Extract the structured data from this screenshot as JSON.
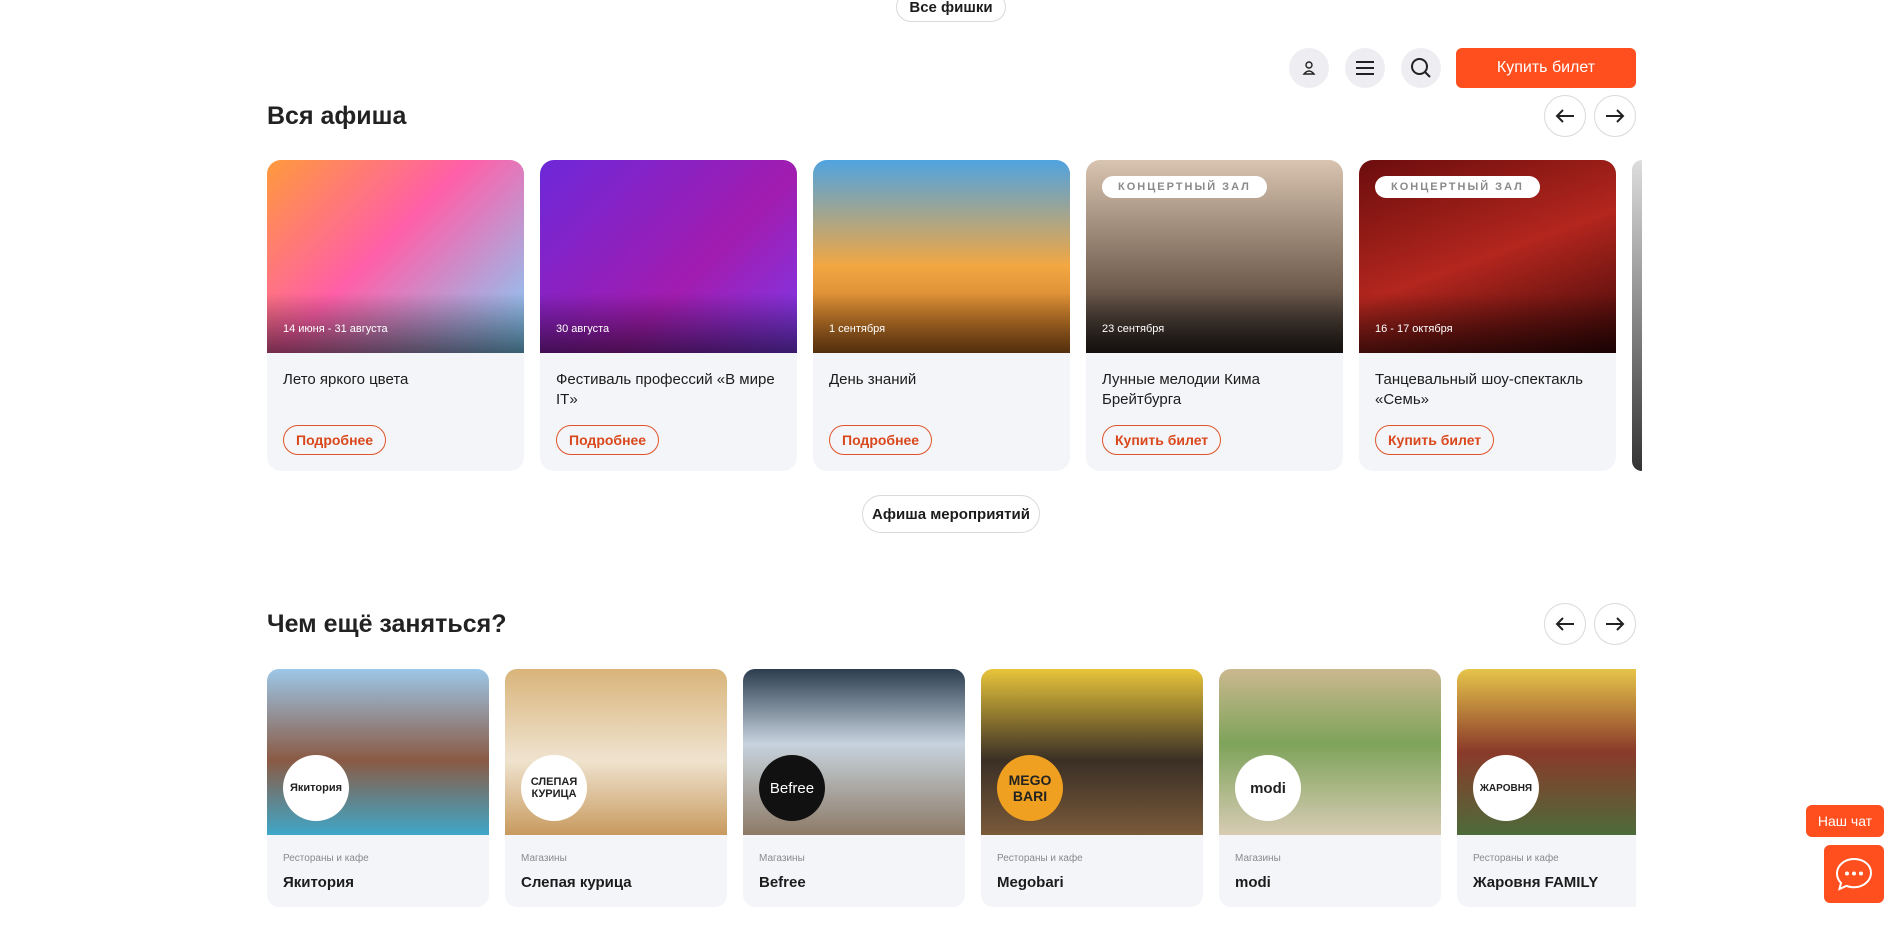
{
  "top_chip": "Все фишки",
  "header": {
    "buy_ticket": "Купить билет",
    "icons": [
      "user-icon",
      "menu-icon",
      "search-icon"
    ]
  },
  "events_section": {
    "title": "Вся афиша",
    "cta": "Афиша мероприятий",
    "cards": [
      {
        "date": "14 июня - 31 августа",
        "title": "Лето яркого цвета",
        "button": "Подробнее",
        "tag": ""
      },
      {
        "date": "30 августа",
        "title": "Фестиваль профессий «В мире IT»",
        "button": "Подробнее",
        "tag": ""
      },
      {
        "date": "1 сентября",
        "title": "День знаний",
        "button": "Подробнее",
        "tag": ""
      },
      {
        "date": "23 сентября",
        "title": "Лунные мелодии Кима Брейтбурга",
        "button": "Купить билет",
        "tag": "КОНЦЕРТНЫЙ ЗАЛ"
      },
      {
        "date": "16 - 17 октября",
        "title": "Танцевальный шоу-спектакль «Семь»",
        "button": "Купить билет",
        "tag": "КОНЦЕРТНЫЙ ЗАЛ"
      }
    ]
  },
  "places_section": {
    "title": "Чем ещё заняться?",
    "cards": [
      {
        "category": "Рестораны и кафе",
        "name": "Якитория",
        "logo": "Якитория"
      },
      {
        "category": "Магазины",
        "name": "Слепая курица",
        "logo": "СЛЕПАЯ КУРИЦА"
      },
      {
        "category": "Магазины",
        "name": "Befree",
        "logo": "Befree"
      },
      {
        "category": "Рестораны и кафе",
        "name": "Megobari",
        "logo": "MEGO BARI"
      },
      {
        "category": "Магазины",
        "name": "modi",
        "logo": "modi"
      },
      {
        "category": "Рестораны и кафе",
        "name": "Жаровня FAMILY",
        "logo": "ЖАРОВНЯ"
      }
    ]
  },
  "chat": {
    "label": "Наш чат"
  },
  "colors": {
    "accent": "#ff4f1f",
    "card_bg": "#f4f5f9"
  }
}
